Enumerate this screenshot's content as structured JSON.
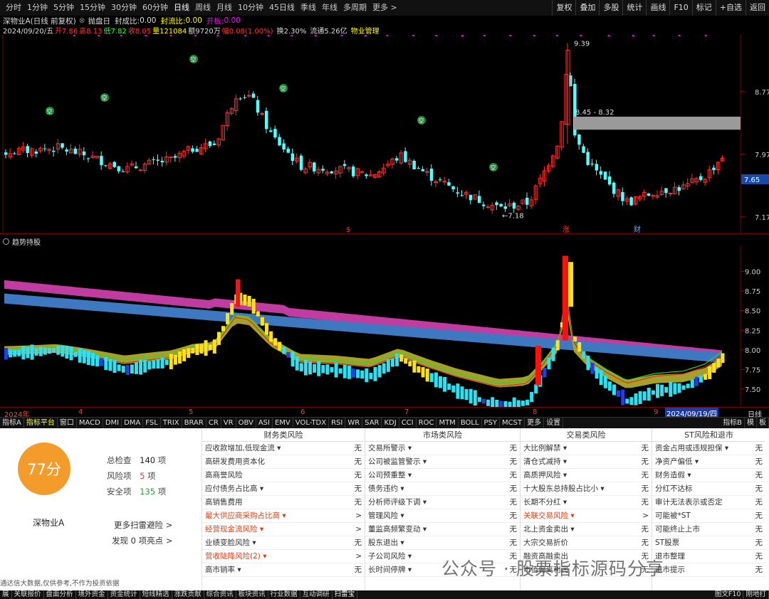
{
  "topbar": {
    "tabs": [
      "分时",
      "1分钟",
      "5分钟",
      "15分钟",
      "30分钟",
      "60分钟",
      "日线",
      "周线",
      "月线",
      "10分钟",
      "45日线",
      "季线",
      "年线",
      "多周期",
      "更多 >"
    ],
    "active": "日线",
    "right": [
      "复权",
      "叠加",
      "多股",
      "统计",
      "画线",
      "F10",
      "标记",
      "+自选",
      "返回"
    ]
  },
  "title": {
    "name": "深物业A(日线 前复权)",
    "sep": "⊗",
    "indicator": "抛盘日",
    "fcb_label": "封成比:",
    "fcb": "0.00",
    "flb_label": "封流比:",
    "flb": "0.00",
    "kb_label": "开板:",
    "kb": "0.00"
  },
  "info": {
    "date": "2024/09/20/五",
    "open_label": "开",
    "open": "7.86",
    "high_label": "高",
    "high": "8.13",
    "low_label": "低",
    "low": "7.82",
    "close_label": "收",
    "close": "8.05",
    "vol_label": "量",
    "vol": "121084",
    "amt_label": "额",
    "amt": "9720万",
    "chg_label": "幅",
    "chg": "0.08(1.00%)",
    "turn_label": "换",
    "turn": "2.30%",
    "float_label": "流通",
    "float": "5.26亿",
    "sector": "物业管理"
  },
  "kchart": {
    "price_axis": [
      "8.77",
      "7.97",
      "7.17"
    ],
    "cur_price": "7.65",
    "high_tag": "9.39",
    "low_tag": "←7.18",
    "gap_label": "8.45 - 8.32",
    "markers": [
      "$",
      "涨",
      "财"
    ],
    "kong": "空"
  },
  "sub": {
    "title": "趋势持股",
    "axis": [
      "9.00",
      "8.75",
      "8.50",
      "8.25",
      "8.00",
      "7.75",
      "7.50"
    ]
  },
  "xaxis": {
    "labels": [
      "2024年",
      "4",
      "5",
      "6",
      "7",
      "8",
      "9"
    ],
    "cur": "2024/09/19/四",
    "period": "日线"
  },
  "indtabs": [
    "指标A",
    "指标平台",
    "窗口",
    "MACD",
    "DMI",
    "DMA",
    "FSL",
    "TRIX",
    "BRAR",
    "CR",
    "VR",
    "OBV",
    "ASI",
    "EMV",
    "VOL-TDX",
    "RSI",
    "WR",
    "SAR",
    "KDJ",
    "CCI",
    "ROC",
    "MTM",
    "BOLL",
    "PSY",
    "MCST",
    "更多",
    "设置"
  ],
  "indtabs_right": [
    "指标B",
    "模",
    "板"
  ],
  "panel": {
    "score": "77分",
    "stock": "深物业A",
    "total_label": "总检查",
    "total": "140",
    "unit": "项",
    "risk_label": "风险项",
    "risk": "5",
    "safe_label": "安全项",
    "safe": "135",
    "more": "更多扫雷避险 >",
    "find_pre": "发现",
    "find_n": "0",
    "find_post": "项亮点 >",
    "disclaimer": "通达信大数据,仅供参考,不作为投资依据",
    "cats": [
      {
        "title": "财务类风险",
        "rows": [
          [
            "应收款增加,低现金流 ▾",
            "无",
            0
          ],
          [
            "高研发费用资本化",
            "无",
            0
          ],
          [
            "高商誉风险",
            "无",
            0
          ],
          [
            "应付债务占比高 ▾",
            "无",
            0
          ],
          [
            "高销售费用",
            "无",
            0
          ],
          [
            "最大供应商采购占比高 ▾",
            ">",
            1
          ],
          [
            "经营现金流风险 ▾",
            ">",
            1
          ],
          [
            "业绩变脸风险 ▾",
            "无",
            0
          ],
          [
            "营收陡降风险(2) ▾",
            ">",
            1
          ],
          [
            "高市销率 ▾",
            "无",
            0
          ]
        ]
      },
      {
        "title": "市场类风险",
        "rows": [
          [
            "交易所警示 ▾",
            "无",
            0
          ],
          [
            "公司被监管警示 ▾",
            "无",
            0
          ],
          [
            "公司预重整 ▾",
            "无",
            0
          ],
          [
            "债务违约 ▾",
            "无",
            0
          ],
          [
            "分析师评级下调 ▾",
            "无",
            0
          ],
          [
            "管理风险 ▾",
            "无",
            0
          ],
          [
            "董监高频繁变动 ▾",
            "无",
            0
          ],
          [
            "股东退出 ▾",
            "无",
            0
          ],
          [
            "子公司风险 ▾",
            "无",
            0
          ],
          [
            "长时间停牌 ▾",
            "无",
            0
          ]
        ]
      },
      {
        "title": "交易类风险",
        "rows": [
          [
            "大比例解禁 ▾",
            "无",
            0
          ],
          [
            "清仓式减持 ▾",
            "无",
            0
          ],
          [
            "高质押风险 ▾",
            "无",
            0
          ],
          [
            "十大股东总持股占比小 ▾",
            "无",
            0
          ],
          [
            "长期不分红 ▾",
            "无",
            0
          ],
          [
            "关联交易风险 ▾",
            ">",
            1
          ],
          [
            "北上资金卖出 ▾",
            "无",
            0
          ],
          [
            "大宗交易折价",
            "无",
            0
          ],
          [
            "融资高融卖出",
            "无",
            0
          ],
          [
            "市值偏离利润",
            "无",
            0
          ]
        ]
      },
      {
        "title": "ST风险和退市",
        "rows": [
          [
            "资金占用或违规担保 ▾",
            "无",
            0
          ],
          [
            "净资产偏低 ▾",
            "无",
            0
          ],
          [
            "财务造假 ▾",
            "无",
            0
          ],
          [
            "分红不达标",
            "无",
            0
          ],
          [
            "审计无法表示或否定",
            "无",
            0
          ],
          [
            "可能被*ST",
            "无",
            0
          ],
          [
            "可能终止上市",
            "无",
            0
          ],
          [
            "ST股票",
            "无",
            0
          ],
          [
            "退市整理",
            "无",
            0
          ],
          [
            "退市提示",
            "无",
            0
          ]
        ]
      }
    ]
  },
  "watermark": "公众号 · 股票指标源码分享",
  "bottombar": [
    "展",
    "关联报价",
    "盘面分析",
    "境外资金",
    "资金统计",
    "短线精选",
    "涨跌贡献",
    "综合资讯",
    "板块资讯",
    "行业数据",
    "互动调研",
    "扫雷宝"
  ],
  "bottom_right": [
    "图文F10",
    "刚地打"
  ]
}
